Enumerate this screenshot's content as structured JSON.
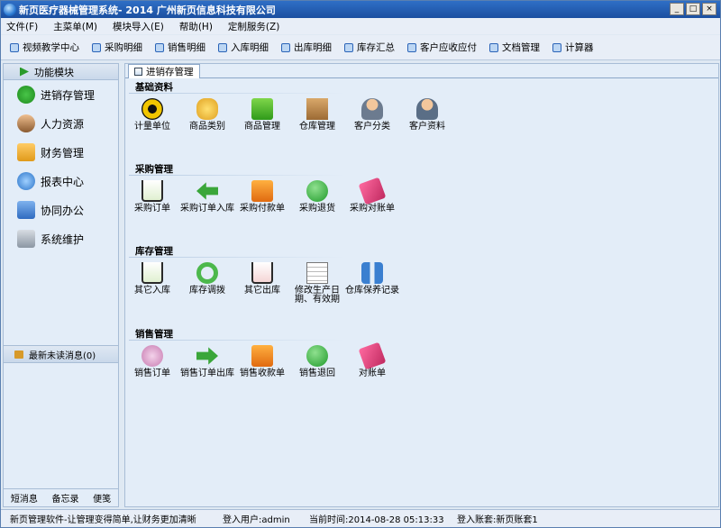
{
  "window": {
    "title": "新页医疗器械管理系统- 2014 广州新页信息科技有限公司",
    "min": "_",
    "max": "□",
    "close": "×"
  },
  "menu": [
    "文件(F)",
    "主菜单(M)",
    "模块导入(E)",
    "帮助(H)",
    "定制服务(Z)"
  ],
  "toolbar": [
    "视频教学中心",
    "采购明细",
    "销售明细",
    "入库明细",
    "出库明细",
    "库存汇总",
    "客户应收应付",
    "文档管理",
    "计算器"
  ],
  "sidebar": {
    "header": "功能模块",
    "items": [
      "进销存管理",
      "人力资源",
      "财务管理",
      "报表中心",
      "协同办公",
      "系统维护"
    ],
    "messages": "最新未读消息(0)",
    "bottom": [
      "短消息",
      "备忘录",
      "便笺"
    ]
  },
  "tab": "进销存管理",
  "sections": [
    {
      "title": "基础资料",
      "items": [
        "计量单位",
        "商品类别",
        "商品管理",
        "仓库管理",
        "客户分类",
        "客户资料"
      ]
    },
    {
      "title": "采购管理",
      "items": [
        "采购订单",
        "采购订单入库",
        "采购付款单",
        "采购退货",
        "采购对账单"
      ]
    },
    {
      "title": "库存管理",
      "items": [
        "其它入库",
        "库存调拨",
        "其它出库",
        "修改生产日期、有效期",
        "仓库保养记录"
      ]
    },
    {
      "title": "销售管理",
      "items": [
        "销售订单",
        "销售订单出库",
        "销售收款单",
        "销售退回",
        "对账单"
      ]
    }
  ],
  "icon_names": {
    "sidebar": [
      "check-icon",
      "people-icon",
      "folder-icon",
      "refresh-icon",
      "calendar-icon",
      "lock-icon"
    ],
    "basic": [
      "radiation-icon",
      "gears-icon",
      "shopping-bag-icon",
      "box-icon",
      "users-icon",
      "user-icon"
    ],
    "purchase": [
      "cart-add-icon",
      "arrow-left-icon",
      "rss-pay-icon",
      "green-circle-icon",
      "eraser-icon"
    ],
    "stock": [
      "cart-add-icon",
      "recycle-icon",
      "cart-remove-icon",
      "table-icon",
      "bars-icon"
    ],
    "sales": [
      "discount-icon",
      "arrow-right-icon",
      "rss-add-icon",
      "green-circle-icon",
      "eraser-icon"
    ]
  },
  "status": {
    "slogan": "新页管理软件-让管理变得简单,让财务更加清晰",
    "user": "登入用户:admin",
    "time": "当前时间:2014-08-28 05:13:33",
    "account": "登入账套:新页账套1"
  },
  "colors": {
    "title_bar": "#1b4fa0",
    "panel_bg": "#e3edf8",
    "accent_green": "#2a9a2a"
  }
}
